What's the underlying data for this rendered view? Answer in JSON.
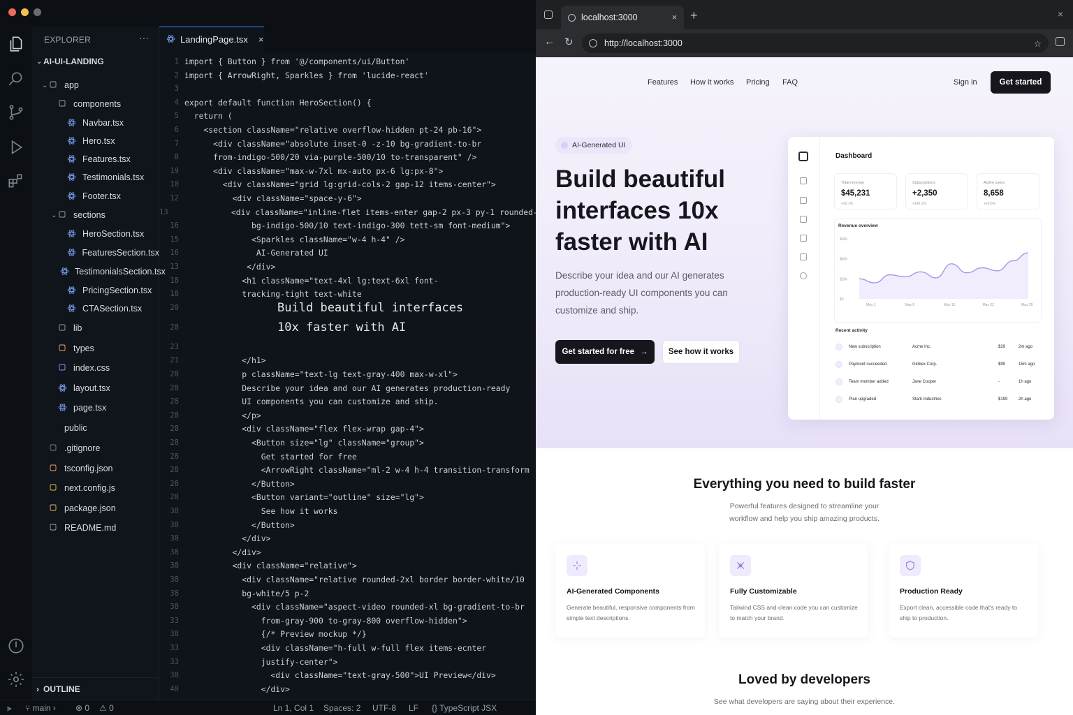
{
  "editor": {
    "explorer_label": "EXPLORER",
    "explorer_more": "···",
    "project_name": "AI-UI-LANDING",
    "tree": [
      {
        "label": "app",
        "depth": 0,
        "type": "folder-open"
      },
      {
        "label": "components",
        "depth": 1,
        "type": "folder-loading"
      },
      {
        "label": "Navbar.tsx",
        "depth": 2,
        "type": "react"
      },
      {
        "label": "Hero.tsx",
        "depth": 2,
        "type": "react"
      },
      {
        "label": "Features.tsx",
        "depth": 2,
        "type": "react"
      },
      {
        "label": "Testimonials.tsx",
        "depth": 2,
        "type": "react"
      },
      {
        "label": "Footer.tsx",
        "depth": 2,
        "type": "react"
      },
      {
        "label": "sections",
        "depth": 1,
        "type": "folder-open"
      },
      {
        "label": "HeroSection.tsx",
        "depth": 2,
        "type": "react"
      },
      {
        "label": "FeaturesSection.tsx",
        "depth": 2,
        "type": "react"
      },
      {
        "label": "TestimonialsSection.tsx",
        "depth": 2,
        "type": "react"
      },
      {
        "label": "PricingSection.tsx",
        "depth": 2,
        "type": "react"
      },
      {
        "label": "CTASection.tsx",
        "depth": 2,
        "type": "react"
      },
      {
        "label": "lib",
        "depth": 1,
        "type": "folder"
      },
      {
        "label": "types",
        "depth": 1,
        "type": "ts"
      },
      {
        "label": "index.css",
        "depth": 1,
        "type": "css"
      },
      {
        "label": "layout.tsx",
        "depth": 1,
        "type": "react"
      },
      {
        "label": "page.tsx",
        "depth": 1,
        "type": "react"
      },
      {
        "label": "public",
        "depth": 0,
        "type": "none"
      },
      {
        "label": ".gitignore",
        "depth": 0,
        "type": "git"
      },
      {
        "label": "tsconfig.json",
        "depth": 0,
        "type": "ts"
      },
      {
        "label": "next.config.js",
        "depth": 0,
        "type": "js"
      },
      {
        "label": "package.json",
        "depth": 0,
        "type": "json"
      },
      {
        "label": "README.md",
        "depth": 0,
        "type": "info"
      }
    ],
    "outline_label": "OUTLINE",
    "tab_label": "LandingPage.tsx",
    "tab_close": "×",
    "code_lines": [
      {
        "n": "1",
        "t": "import { Button } from '@/components/ui/Button'"
      },
      {
        "n": "2",
        "t": "import { ArrowRight, Sparkles } from 'lucide-react'"
      },
      {
        "n": "3",
        "t": ""
      },
      {
        "n": "4",
        "t": "export default function HeroSection() {"
      },
      {
        "n": "5",
        "t": "  return ("
      },
      {
        "n": "6",
        "t": "    <section className=\"relative overflow-hidden pt-24 pb-16\">"
      },
      {
        "n": "7",
        "t": "      <div className=\"absolute inset-0 -z-10 bg-gradient-to-br"
      },
      {
        "n": "8",
        "t": "      from-indigo-500/20 via-purple-500/10 to-transparent\" />"
      },
      {
        "n": "19",
        "t": "      <div className=\"max-w-7xl mx-auto px-6 lg:px-8\">"
      },
      {
        "n": "10",
        "t": "        <div className=\"grid lg:grid-cols-2 gap-12 items-center\">"
      },
      {
        "n": "12",
        "t": "          <div className=\"space-y-6\">"
      },
      {
        "n": "13",
        "t": "            <div className=\"inline-flet items-enter gap-2 px-3 py-1 rounded-"
      },
      {
        "n": "16",
        "t": "              bg-indigo-500/10 text-indigo-300 tett-sm font-medium\">"
      },
      {
        "n": "15",
        "t": "              <Sparkles className=\"w-4 h-4\" />"
      },
      {
        "n": "16",
        "t": "               AI-Generated UI"
      },
      {
        "n": "13",
        "t": "             </div>"
      },
      {
        "n": "18",
        "t": "            <h1 className=\"text-4xl lg:text-6xl font-"
      },
      {
        "n": "18",
        "t": "            tracking-tight text-white"
      },
      {
        "n": "20",
        "t": "             Build beautiful interfaces",
        "big": true
      },
      {
        "n": "28",
        "t": "             10x faster with AI",
        "big": true
      },
      {
        "n": "23",
        "t": ""
      },
      {
        "n": "21",
        "t": "            </h1>"
      },
      {
        "n": "28",
        "t": "            p className=\"text-lg text-gray-400 max-w-xl\">"
      },
      {
        "n": "28",
        "t": "            Describe your idea and our AI generates production-ready"
      },
      {
        "n": "28",
        "t": "            UI components you can customize and ship."
      },
      {
        "n": "28",
        "t": "            </p>"
      },
      {
        "n": "28",
        "t": "            <div className=\"flex flex-wrap gap-4\">"
      },
      {
        "n": "28",
        "t": "              <Button size=\"lg\" className=\"group\">"
      },
      {
        "n": "28",
        "t": "                Get started for free"
      },
      {
        "n": "28",
        "t": "                <ArrowRight className=\"ml-2 w-4 h-4 transition-transform"
      },
      {
        "n": "28",
        "t": "              </Button>"
      },
      {
        "n": "28",
        "t": "              <Button variant=\"outline\" size=\"lg\">"
      },
      {
        "n": "38",
        "t": "                See how it works"
      },
      {
        "n": "38",
        "t": "              </Button>"
      },
      {
        "n": "38",
        "t": "            </div>"
      },
      {
        "n": "38",
        "t": "          </div>"
      },
      {
        "n": "38",
        "t": "          <div className=\"relative\">"
      },
      {
        "n": "38",
        "t": "            <div className=\"relative rounded-2xl border border-white/10"
      },
      {
        "n": "38",
        "t": "            bg-white/5 p-2"
      },
      {
        "n": "38",
        "t": "              <div className=\"aspect-video rounded-xl bg-gradient-to-br"
      },
      {
        "n": "33",
        "t": "                from-gray-900 to-gray-800 overflow-hidden\">"
      },
      {
        "n": "38",
        "t": "                {/* Preview mockup */}"
      },
      {
        "n": "33",
        "t": "                <div className=\"h-full w-full flex items-ecnter"
      },
      {
        "n": "33",
        "t": "                justify-center\">"
      },
      {
        "n": "38",
        "t": "                  <div className=\"text-gray-500\">UI Preview</div>"
      },
      {
        "n": "40",
        "t": "                </div>"
      },
      {
        "n": "48",
        "t": "              </div>"
      },
      {
        "n": "40",
        "t": "            </div>"
      }
    ],
    "status": {
      "branch": "main",
      "errors": "0",
      "warnings": "0",
      "position": "Ln 1, Col 1",
      "spaces": "Spaces: 2",
      "encoding": "UTF-8",
      "eol": "LF",
      "language": "TypeScript JSX"
    }
  },
  "browser": {
    "tab_title": "localhost:3000",
    "tab_close": "×",
    "new_tab": "+",
    "url": "http://localhost:3000",
    "window_close": "×"
  },
  "site": {
    "nav": [
      "Features",
      "How it works",
      "Pricing",
      "FAQ"
    ],
    "sign_in": "Sign in",
    "get_started": "Get started",
    "badge": "AI-Generated UI",
    "hero_title": "Build beautiful interfaces 10x faster with AI",
    "hero_desc": "Describe your idea and our AI generates production-ready UI components you can customize and ship.",
    "cta_primary": "Get started for free",
    "cta_secondary": "See how it works",
    "dashboard": {
      "title": "Dashboard",
      "stats": [
        {
          "label": "Total revenue",
          "value": "$45,231",
          "delta": "+20.1%"
        },
        {
          "label": "Subscriptions",
          "value": "+2,350",
          "delta": "+180.1%"
        },
        {
          "label": "Active users",
          "value": "8,658",
          "delta": "+20.6%"
        }
      ],
      "revenue_title": "Revenue overview",
      "y_ticks": [
        "$60k",
        "$40k",
        "$20k",
        "$0"
      ],
      "x_ticks": [
        "May 1",
        "May 8",
        "May 15",
        "May 22",
        "May 29"
      ],
      "chart_values": [
        20,
        16,
        24,
        22,
        27,
        21,
        35,
        26,
        31,
        28,
        38,
        46
      ],
      "recent_title": "Recent activity",
      "activity": [
        {
          "event": "New subscription",
          "who": "Acme Inc.",
          "amount": "$29",
          "time": "2m ago"
        },
        {
          "event": "Payment succeeded",
          "who": "Globex Corp.",
          "amount": "$99",
          "time": "15m ago"
        },
        {
          "event": "Team member added",
          "who": "Jane Cooper",
          "amount": "-",
          "time": "1h ago"
        },
        {
          "event": "Plan upgraded",
          "who": "Stark Industries",
          "amount": "$199",
          "time": "2h ago"
        }
      ]
    },
    "features_title": "Everything you need to build faster",
    "features_sub": "Powerful features designed to streamline your workflow and help you ship amazing products.",
    "features": [
      {
        "title": "AI-Generated Components",
        "desc": "Generate beautiful, responsive components from simple text descriptions.",
        "icon": "sparkle-icon"
      },
      {
        "title": "Fully Customizable",
        "desc": "Tailwind CSS and clean code you can customize to match your brand.",
        "icon": "tools-icon"
      },
      {
        "title": "Production Ready",
        "desc": "Export clean, accessible code that's ready to ship to production.",
        "icon": "shield-icon"
      }
    ],
    "testimonials_title": "Loved by developers",
    "testimonials_sub": "See what developers are saying about their experience."
  },
  "colors": {
    "accent": "#6d5bd0",
    "editor_bg": "#0f131a",
    "dark_button": "#16161c"
  }
}
